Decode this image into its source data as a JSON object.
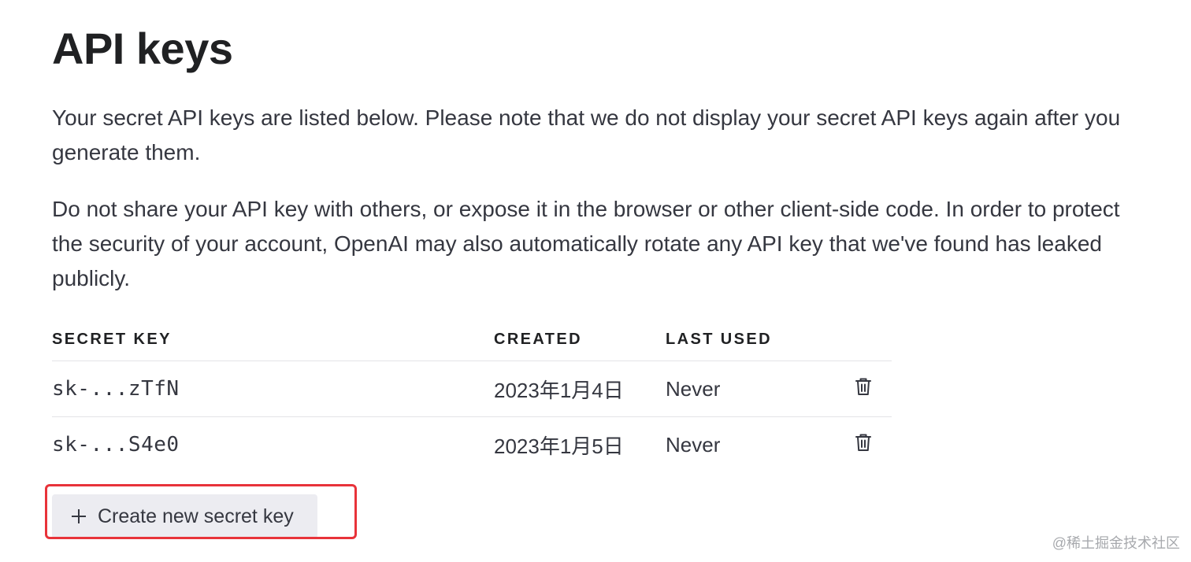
{
  "header": {
    "title": "API keys"
  },
  "intro": {
    "paragraph_1": "Your secret API keys are listed below. Please note that we do not display your secret API keys again after you generate them.",
    "paragraph_2": "Do not share your API key with others, or expose it in the browser or other client-side code. In order to protect the security of your account, OpenAI may also automatically rotate any API key that we've found has leaked publicly."
  },
  "table": {
    "columns": {
      "secret_key": "SECRET KEY",
      "created": "CREATED",
      "last_used": "LAST USED"
    },
    "rows": [
      {
        "key": "sk-...zTfN",
        "created": "2023年1月4日",
        "last_used": "Never",
        "action_icon": "trash-icon"
      },
      {
        "key": "sk-...S4e0",
        "created": "2023年1月5日",
        "last_used": "Never",
        "action_icon": "trash-icon"
      }
    ]
  },
  "actions": {
    "create_label": "Create new secret key",
    "create_icon": "plus-icon"
  },
  "watermark": "@稀土掘金技术社区",
  "colors": {
    "highlight": "#e8333a",
    "button_bg": "#ececf1",
    "text": "#353740"
  }
}
